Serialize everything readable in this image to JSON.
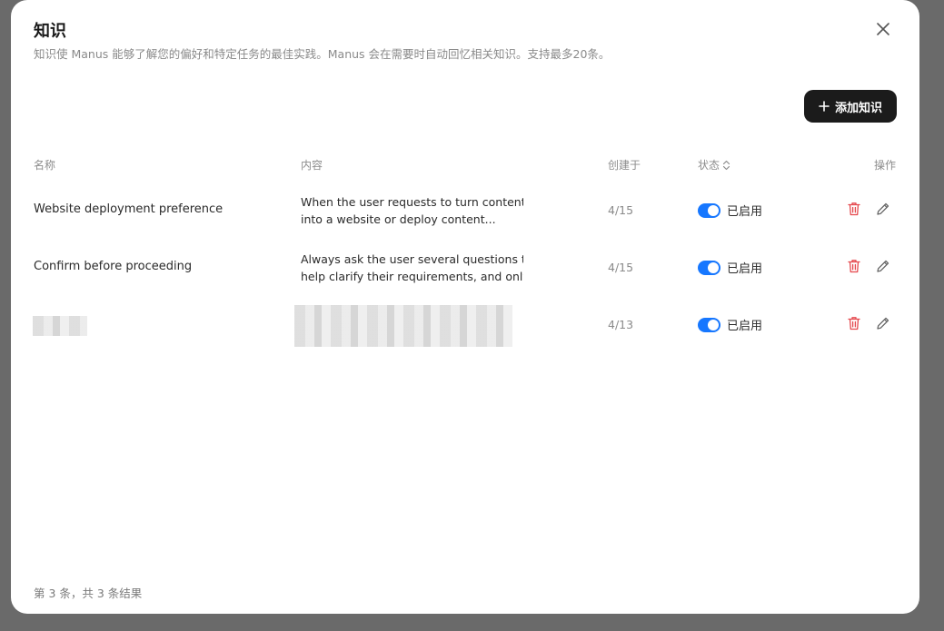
{
  "modal": {
    "title": "知识",
    "subtitle": "知识使 Manus 能够了解您的偏好和特定任务的最佳实践。Manus 会在需要时自动回忆相关知识。支持最多20条。",
    "add_button_label": "添加知识",
    "close_icon": "close-icon"
  },
  "table": {
    "headers": {
      "name": "名称",
      "content": "内容",
      "created": "创建于",
      "status": "状态",
      "actions": "操作"
    },
    "rows": [
      {
        "name": "Website deployment preference",
        "content_line1": "When the user requests to turn content",
        "content_line2": "into a website or deploy content...",
        "created": "4/15",
        "status": "已启用"
      },
      {
        "name": "Confirm before proceeding",
        "content_line1": "Always ask the user several questions to",
        "content_line2": "help clarify their requirements, and only...",
        "created": "4/15",
        "status": "已启用"
      },
      {
        "name": "",
        "content_line1": "",
        "content_line2": "",
        "created": "4/13",
        "status": "已启用"
      }
    ]
  },
  "footer": {
    "summary": "第 3 条，共 3 条结果"
  },
  "colors": {
    "accent": "#1677ff",
    "primary_button": "#1b1b1b",
    "delete": "#e5484d"
  }
}
